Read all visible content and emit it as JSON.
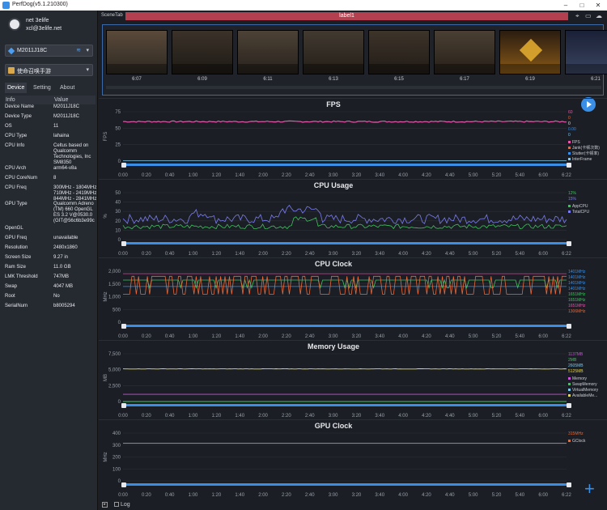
{
  "window": {
    "title": "PerfDog(v5.1.210300)"
  },
  "user": {
    "name": "net 3elife",
    "email": "xcl@3elife.net"
  },
  "device_select": {
    "value": "M2011J18C"
  },
  "app_select": {
    "value": "使命召唤手游"
  },
  "tabs": [
    "Device",
    "Setting",
    "About"
  ],
  "info": {
    "head": [
      "Info",
      "Value"
    ],
    "rows": [
      [
        "Device Name",
        "M2011J18C"
      ],
      [
        "Device Type",
        "M2011J18C"
      ],
      [
        "OS",
        "11"
      ],
      [
        "CPU Type",
        "lahaina"
      ],
      [
        "CPU Info",
        "Celtus based on Qualcomm Technologies, Inc SM8350"
      ],
      [
        "CPU Arch",
        "arm64-v8a"
      ],
      [
        "CPU CoreNum",
        "8"
      ],
      [
        "CPU Freq",
        "300MHz - 1804MHz 710MHz - 2419MHz 844MHz - 2841MHz"
      ],
      [
        "GPU Type",
        "Qualcomm Adreno (TM) 660 OpenGL ES 3.2 V@0530.0 (GIT@56c6b3e99c"
      ],
      [
        "OpenGL",
        ""
      ],
      [
        "GPU Freq",
        "unavailable"
      ],
      [
        "Resolution",
        "2480x1860"
      ],
      [
        "Screen Size",
        "9.27 in"
      ],
      [
        "Ram Size",
        "11.0 GB"
      ],
      [
        "LMK Threshold",
        "747MB"
      ],
      [
        "Swap",
        "4047 MB"
      ],
      [
        "Root",
        "No"
      ],
      [
        "SerialNum",
        "b8005294"
      ]
    ]
  },
  "scene": {
    "tab": "SceneTab",
    "label": "label1"
  },
  "thumbnails": [
    "6:07",
    "6:09",
    "6:11",
    "6:13",
    "6:15",
    "6:17",
    "6:19",
    "6:21"
  ],
  "time_ticks": [
    "0:00",
    "0:20",
    "0:40",
    "1:00",
    "1:20",
    "1:40",
    "2:00",
    "2:20",
    "2:40",
    "3:00",
    "3:20",
    "3:40",
    "4:00",
    "4:20",
    "4:40",
    "5:00",
    "5:20",
    "5:40",
    "6:00",
    "6:22"
  ],
  "charts": [
    {
      "key": "fps",
      "title": "FPS",
      "ylabel": "FPS",
      "yticks": [
        "75",
        "50",
        "25",
        "0"
      ],
      "ymax": 75,
      "legend_values": [
        {
          "text": "60",
          "color": "#e05aa9"
        },
        {
          "text": "0",
          "color": "#e9693a"
        },
        {
          "text": "0",
          "color": "#e6e8ec"
        },
        {
          "text": "0.00",
          "color": "#3a8ee6"
        },
        {
          "text": "0",
          "color": "#7ec4e8"
        }
      ],
      "legend": [
        {
          "name": "FPS",
          "color": "#e05aa9"
        },
        {
          "name": "Jank(卡顿次数)",
          "color": "#e9693a"
        },
        {
          "name": "Stutter(卡顿率)",
          "color": "#3a8ee6"
        },
        {
          "name": "InterFrame",
          "color": "#7ec4e8"
        }
      ]
    },
    {
      "key": "cpu",
      "title": "CPU Usage",
      "ylabel": "%",
      "yticks": [
        "50",
        "40",
        "30",
        "20",
        "10",
        "0"
      ],
      "ymax": 50,
      "legend_values": [
        {
          "text": "12%",
          "color": "#3fc25e"
        },
        {
          "text": "15%",
          "color": "#7a7df0"
        }
      ],
      "legend": [
        {
          "name": "AppCPU",
          "color": "#3fc25e"
        },
        {
          "name": "TotalCPU",
          "color": "#7a7df0"
        }
      ]
    },
    {
      "key": "clock",
      "title": "CPU Clock",
      "ylabel": "MHz",
      "yticks": [
        "2,000",
        "1,500",
        "1,000",
        "500",
        "0"
      ],
      "ymax": 2000,
      "legend_values": [
        {
          "text": "1401MHz",
          "color": "#3a8ee6"
        },
        {
          "text": "1401MHz",
          "color": "#3a8ee6"
        },
        {
          "text": "1401MHz",
          "color": "#3a8ee6"
        },
        {
          "text": "1401MHz",
          "color": "#3a8ee6"
        },
        {
          "text": "1651MHz",
          "color": "#3fc25e"
        },
        {
          "text": "1651MHz",
          "color": "#3fc25e"
        },
        {
          "text": "1651MHz",
          "color": "#e05aa9"
        },
        {
          "text": "1306MHz",
          "color": "#e9693a"
        }
      ],
      "legend": []
    },
    {
      "key": "mem",
      "title": "Memory Usage",
      "ylabel": "MB",
      "yticks": [
        "7,500",
        "5,000",
        "2,500",
        "0"
      ],
      "ymax": 7500,
      "legend_values": [
        {
          "text": "1137MB",
          "color": "#c655d6"
        },
        {
          "text": "2MB",
          "color": "#3fc25e"
        },
        {
          "text": "2605MB",
          "color": "#7ec4e8"
        },
        {
          "text": "5125MB",
          "color": "#e6d545"
        }
      ],
      "legend": [
        {
          "name": "Memory",
          "color": "#c655d6"
        },
        {
          "name": "SwapMemory",
          "color": "#3fc25e"
        },
        {
          "name": "VirtualMemory",
          "color": "#7ec4e8"
        },
        {
          "name": "AvailableMe...",
          "color": "#e6d545"
        }
      ]
    },
    {
      "key": "gpu",
      "title": "GPU Clock",
      "ylabel": "MHz",
      "yticks": [
        "400",
        "300",
        "200",
        "100",
        "0"
      ],
      "ymax": 400,
      "legend_values": [
        {
          "text": "315MHz",
          "color": "#e9693a"
        }
      ],
      "legend": [
        {
          "name": "GClock",
          "color": "#e9693a"
        }
      ]
    }
  ],
  "bottom": {
    "log_label": "Log"
  },
  "colors": {
    "accent": "#3a8ee6",
    "label_tab": "#b3404f"
  }
}
